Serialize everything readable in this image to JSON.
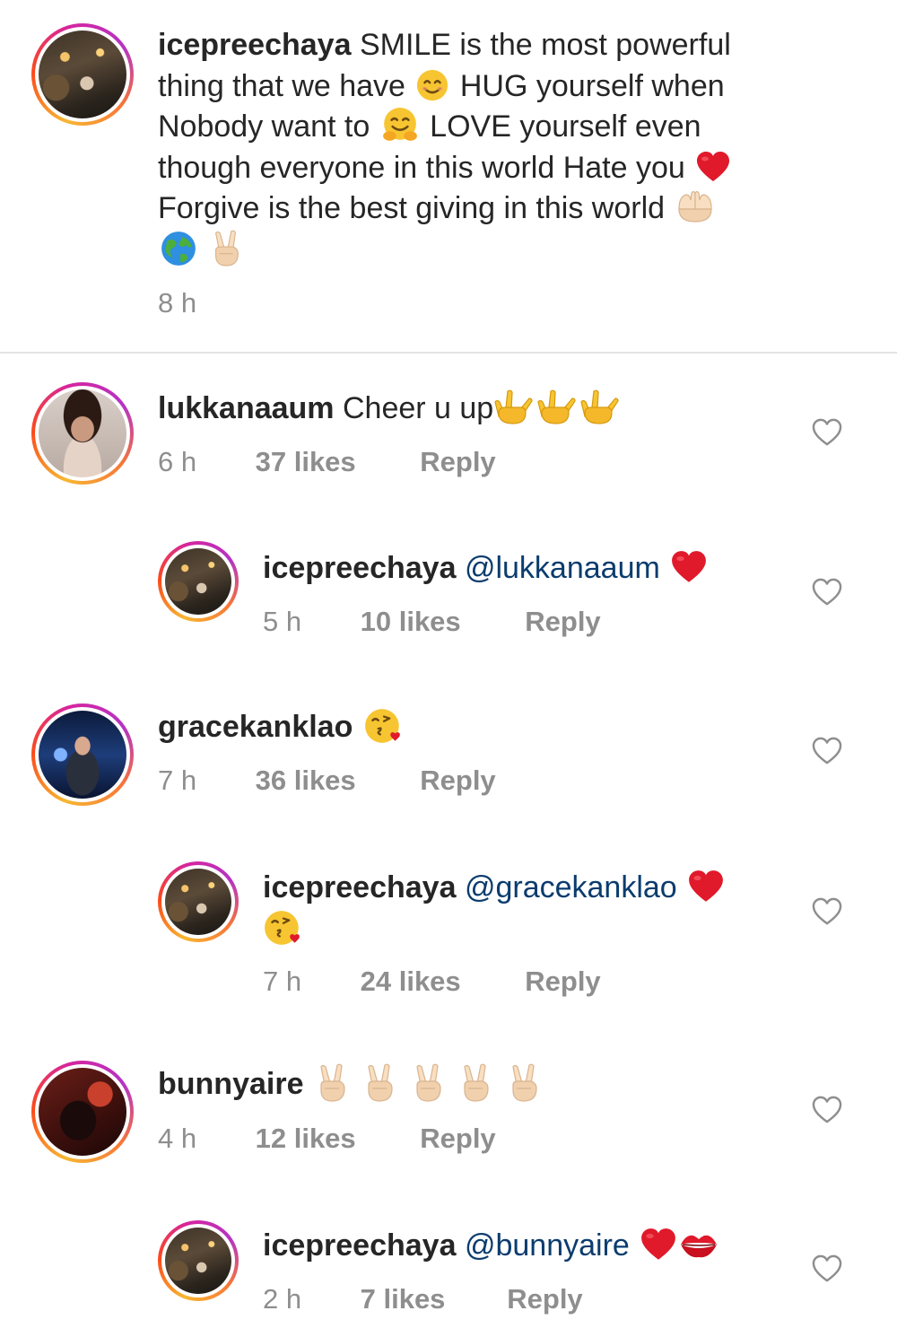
{
  "caption": {
    "username": "icepreechaya",
    "line1": "SMILE is the most powerful",
    "line2a": "thing that we have",
    "line2b": "HUG yourself when",
    "line3a": "Nobody want to",
    "line3b": "LOVE yourself even",
    "line4": "though everyone in this world Hate you",
    "line5": "Forgive is the best giving in this world",
    "time": "8 h",
    "emojis": [
      "smiling-face",
      "hugging-face",
      "red-heart",
      "palms-up-together",
      "globe",
      "victory-hand"
    ]
  },
  "comments": [
    {
      "username": "lukkanaaum",
      "text": "Cheer u up",
      "emojis": [
        "love-you-gesture",
        "love-you-gesture",
        "love-you-gesture"
      ],
      "time": "6 h",
      "likes": "37 likes",
      "reply": "Reply"
    },
    {
      "username": "icepreechaya",
      "mention": "@lukkanaaum",
      "emojis": [
        "red-heart"
      ],
      "time": "5 h",
      "likes": "10 likes",
      "reply": "Reply"
    },
    {
      "username": "gracekanklao",
      "emojis": [
        "kissing-face"
      ],
      "time": "7 h",
      "likes": "36 likes",
      "reply": "Reply"
    },
    {
      "username": "icepreechaya",
      "mention": "@gracekanklao",
      "emojis": [
        "red-heart",
        "kissing-face"
      ],
      "time": "7 h",
      "likes": "24 likes",
      "reply": "Reply"
    },
    {
      "username": "bunnyaire",
      "emojis": [
        "victory-hand",
        "victory-hand",
        "victory-hand",
        "victory-hand",
        "victory-hand"
      ],
      "time": "4 h",
      "likes": "12 likes",
      "reply": "Reply"
    },
    {
      "username": "icepreechaya",
      "mention": "@bunnyaire",
      "emojis": [
        "red-heart",
        "kiss-mark"
      ],
      "time": "2 h",
      "likes": "7 likes",
      "reply": "Reply"
    }
  ],
  "colors": {
    "text": "#262626",
    "meta": "#8e8e8e",
    "mention": "#0b3c6e",
    "heart": "#e0192b"
  }
}
